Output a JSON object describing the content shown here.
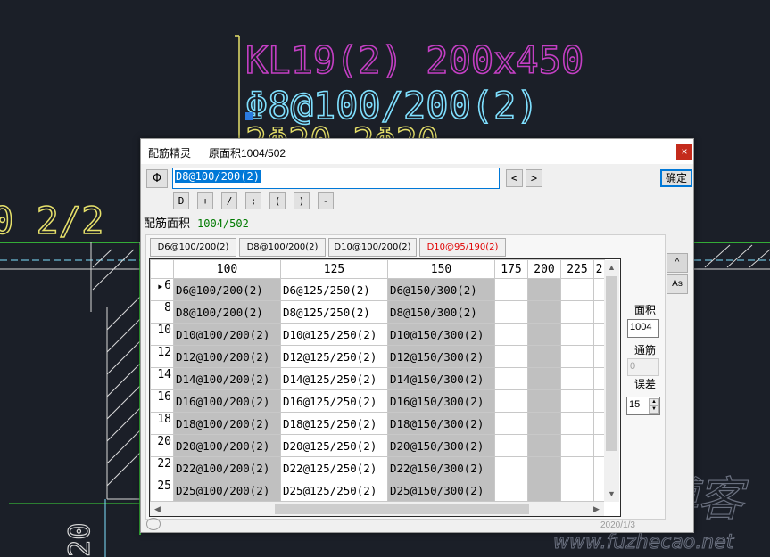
{
  "cad": {
    "title_text": "KL19(2) 200x450",
    "stirrup_text": "Φ8@100/200(2)",
    "partial_text_top": "2Φ20 2Φ20",
    "left_text": "0 2/2",
    "bottom_left_text": "20",
    "colors": {
      "background": "#1b1f28",
      "magenta": "#c43fc4",
      "cyan": "#7fe0ff",
      "yellow": "#e6e06a",
      "green": "#3cdc3c",
      "white": "#d8d8d8"
    }
  },
  "watermark": {
    "brand": "曲靖傅客",
    "site": "www.fuzhecao.net"
  },
  "dialog": {
    "title": "配筋精灵",
    "original_area": "原面积1004/502",
    "close_glyph": "×",
    "rebar_symbol": "Φ",
    "spec_value": "D8@100/200(2)",
    "prev_glyph": "<",
    "next_glyph": ">",
    "confirm_label": "确定",
    "symbols": [
      "D",
      "+",
      "/",
      ";",
      "(",
      ")",
      "-"
    ],
    "area_label": "配筋面积",
    "area_value": "1004/502",
    "tabs": [
      {
        "label": "D6@100/200(2)",
        "highlight": false
      },
      {
        "label": "D8@100/200(2)",
        "highlight": false
      },
      {
        "label": "D10@100/200(2)",
        "highlight": false
      },
      {
        "label": "D10@95/190(2)",
        "highlight": true
      }
    ],
    "grid": {
      "columns": [
        "100",
        "125",
        "150",
        "175",
        "200",
        "225",
        "2"
      ],
      "current_row": 0,
      "rows": [
        {
          "dia": "6",
          "cells": [
            "D6@100/200(2)",
            "D6@125/250(2)",
            "D6@150/300(2)"
          ]
        },
        {
          "dia": "8",
          "cells": [
            "D8@100/200(2)",
            "D8@125/250(2)",
            "D8@150/300(2)"
          ]
        },
        {
          "dia": "10",
          "cells": [
            "D10@100/200(2)",
            "D10@125/250(2)",
            "D10@150/300(2)"
          ]
        },
        {
          "dia": "12",
          "cells": [
            "D12@100/200(2)",
            "D12@125/250(2)",
            "D12@150/300(2)"
          ]
        },
        {
          "dia": "14",
          "cells": [
            "D14@100/200(2)",
            "D14@125/250(2)",
            "D14@150/300(2)"
          ]
        },
        {
          "dia": "16",
          "cells": [
            "D16@100/200(2)",
            "D16@125/250(2)",
            "D16@150/300(2)"
          ]
        },
        {
          "dia": "18",
          "cells": [
            "D18@100/200(2)",
            "D18@125/250(2)",
            "D18@150/300(2)"
          ]
        },
        {
          "dia": "20",
          "cells": [
            "D20@100/200(2)",
            "D20@125/250(2)",
            "D20@150/300(2)"
          ]
        },
        {
          "dia": "22",
          "cells": [
            "D22@100/200(2)",
            "D22@125/250(2)",
            "D22@150/300(2)"
          ]
        },
        {
          "dia": "25",
          "cells": [
            "D25@100/200(2)",
            "D25@125/250(2)",
            "D25@150/300(2)"
          ]
        }
      ]
    },
    "side": {
      "top_button": "^",
      "as_button": "As",
      "area_label": "面积",
      "area_value": "1004",
      "through_label": "通筋",
      "through_value": "0",
      "tolerance_label": "误差",
      "tolerance_value": "15"
    },
    "footer": "2020/1/3"
  }
}
